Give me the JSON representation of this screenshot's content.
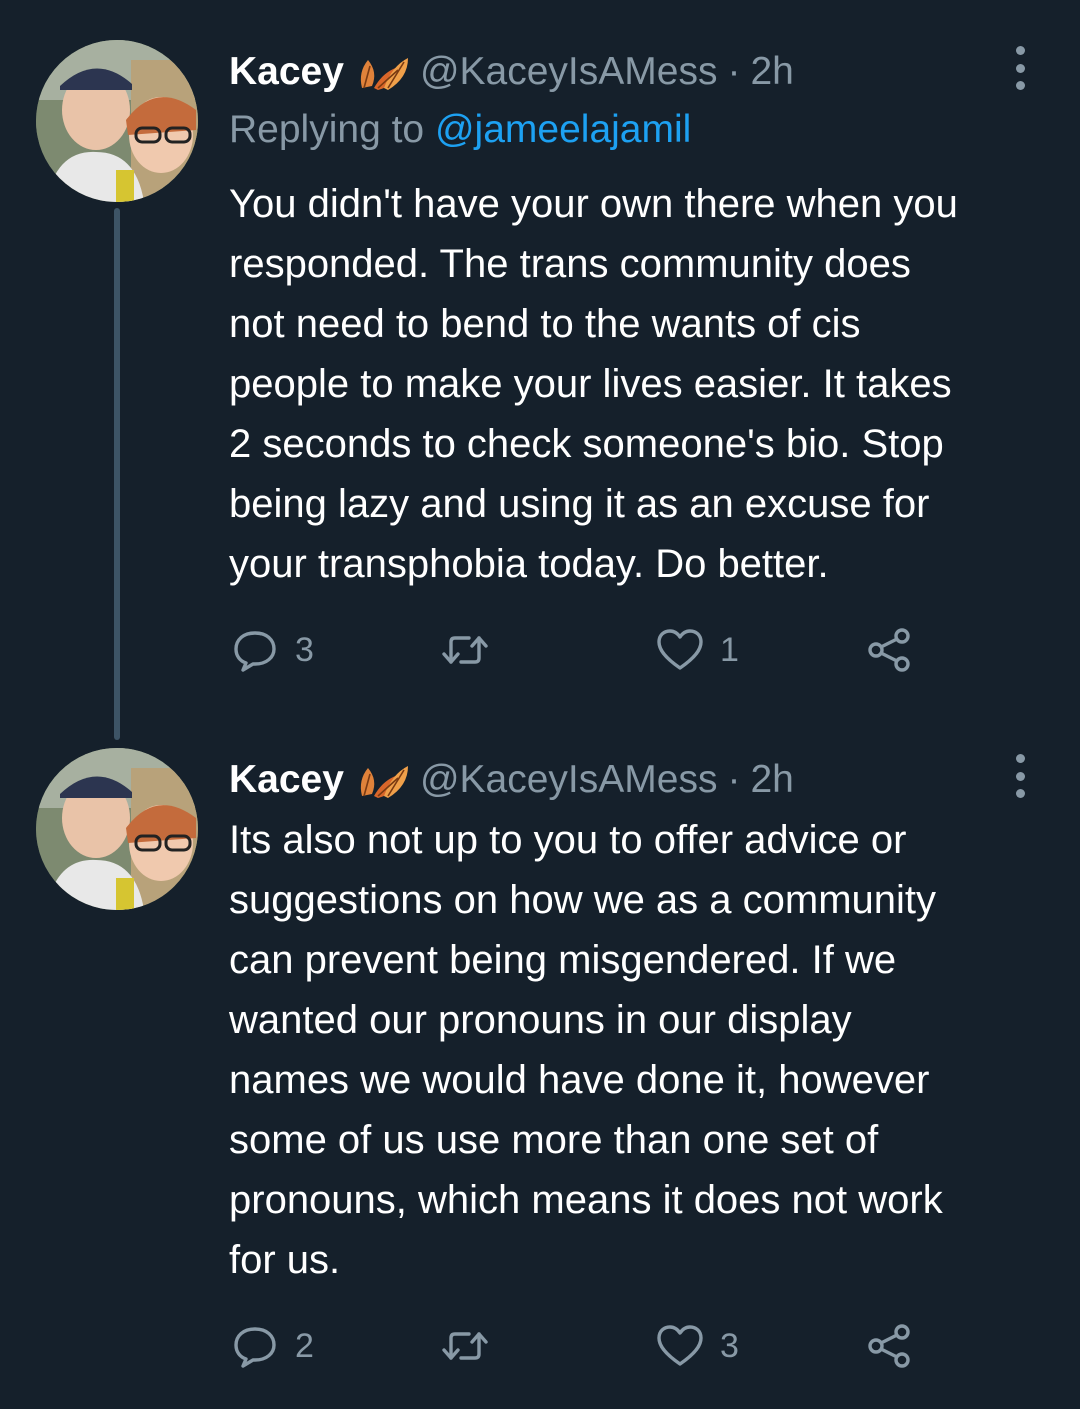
{
  "colors": {
    "background": "#15202b",
    "text_primary": "#ffffff",
    "text_secondary": "#8899a6",
    "link": "#1da1f2",
    "thread_line": "#3d5466"
  },
  "tweets": [
    {
      "display_name": "Kacey",
      "name_emoji": "leaves-icon",
      "handle": "@KaceyIsAMess",
      "separator": "·",
      "time": "2h",
      "replying_prefix": "Replying to",
      "replying_to": "@jameelajamil",
      "text": "You didn't have your own there when you\nresponded. The trans community does\nnot need to bend to the wants of cis\npeople to make your lives easier. It takes\n2 seconds to check someone's bio. Stop\nbeing lazy and using it as an excuse for\nyour transphobia today. Do better.",
      "replies": "3",
      "retweets": "",
      "likes": "1"
    },
    {
      "display_name": "Kacey",
      "name_emoji": "leaves-icon",
      "handle": "@KaceyIsAMess",
      "separator": "·",
      "time": "2h",
      "text": "Its also not up to you to offer advice or\nsuggestions on how we as a community\ncan prevent being misgendered. If we\nwanted our pronouns in our display\nnames we would have done it, however\nsome of us use more than one set of\npronouns, which means it does not work\nfor us.",
      "replies": "2",
      "retweets": "",
      "likes": "3"
    }
  ]
}
